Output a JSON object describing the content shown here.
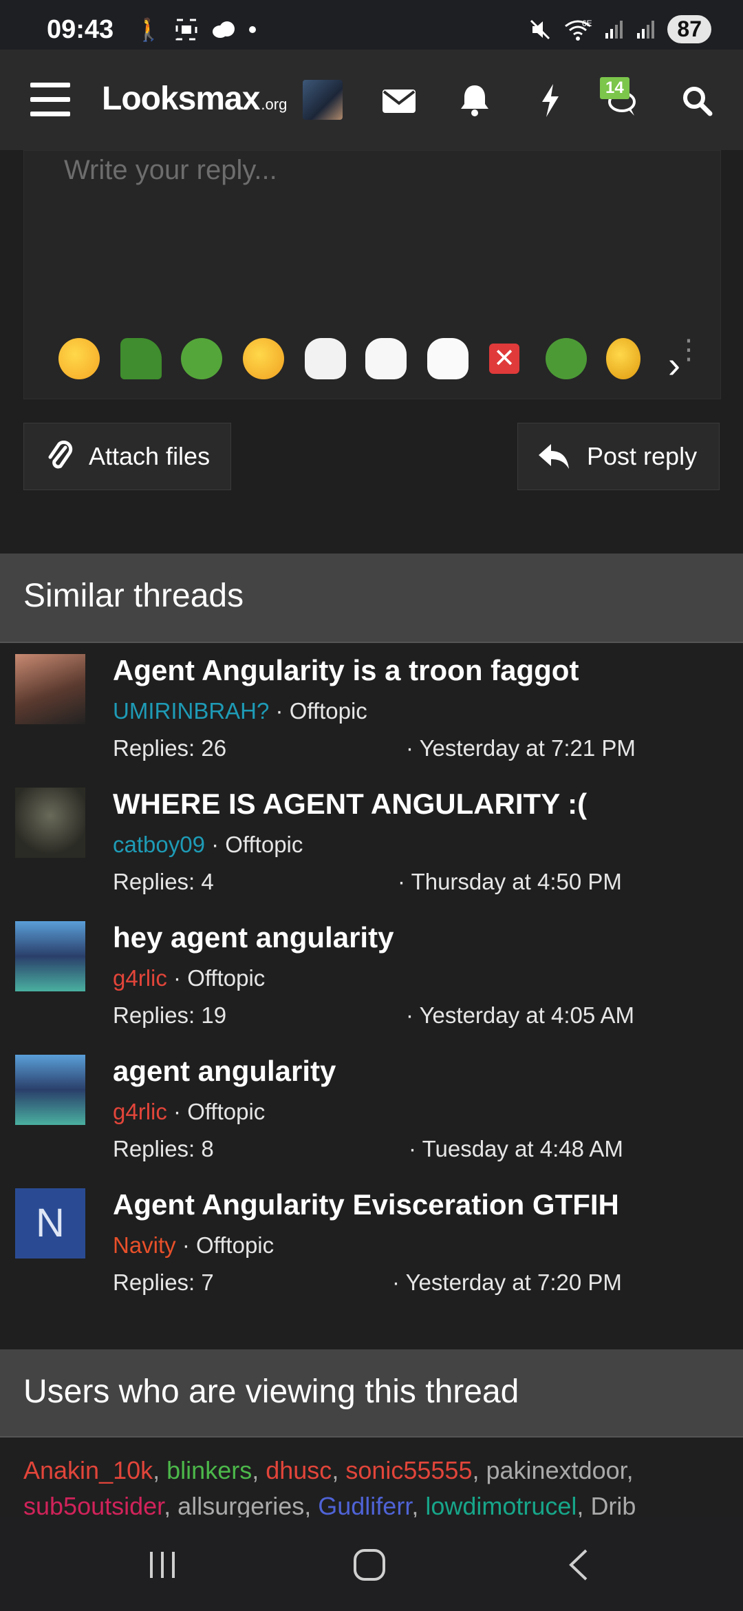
{
  "status_bar": {
    "time": "09:43",
    "network": "6E",
    "battery": "87"
  },
  "header": {
    "logo_main": "Looksmax",
    "logo_suffix": ".org",
    "messages_badge": "14"
  },
  "editor": {
    "placeholder": "Write your reply...",
    "emojis": [
      "rofl-emoji",
      "pepe-emoji",
      "pepe-laugh-emoji",
      "joy-tears-emoji",
      "wojak-emoji",
      "crying-wojak-emoji",
      "soyjak-emoji",
      "x-mark-emoji",
      "pepe-grin-emoji",
      "grin-emoji"
    ]
  },
  "actions": {
    "attach_label": "Attach files",
    "post_label": "Post reply"
  },
  "similar": {
    "heading": "Similar threads",
    "threads": [
      {
        "title": "Agent Angularity is a troon faggot",
        "author": "UMIRINBRAH?",
        "author_color": "#1e9bb6",
        "forum": "Offtopic",
        "replies": "Replies: 26",
        "date": "Yesterday at 7:21 PM"
      },
      {
        "title": "WHERE IS AGENT ANGULARITY :(",
        "author": "catboy09",
        "author_color": "#1e9bb6",
        "forum": "Offtopic",
        "replies": "Replies: 4",
        "date": "Thursday at 4:50 PM"
      },
      {
        "title": "hey agent angularity",
        "author": "g4rlic",
        "author_color": "#e2453a",
        "forum": "Offtopic",
        "replies": "Replies: 19",
        "date": "Yesterday at 4:05 AM"
      },
      {
        "title": "agent angularity",
        "author": "g4rlic",
        "author_color": "#e2453a",
        "forum": "Offtopic",
        "replies": "Replies: 8",
        "date": "Tuesday at 4:48 AM"
      },
      {
        "title": "Agent Angularity Evisceration GTFIH",
        "author": "Navity",
        "author_color": "#e8502a",
        "forum": "Offtopic",
        "replies": "Replies: 7",
        "date": "Yesterday at 7:20 PM",
        "avatar_letter": "N"
      }
    ]
  },
  "viewers": {
    "heading": "Users who are viewing this thread",
    "users": [
      {
        "name": "Anakin_10k",
        "color": "#e2453a"
      },
      {
        "name": "blinkers",
        "color": "#4cb84a"
      },
      {
        "name": "dhusc",
        "color": "#e2453a"
      },
      {
        "name": "sonic55555",
        "color": "#e2453a"
      },
      {
        "name": "pakinextdoor",
        "color": "#aaaaaa"
      },
      {
        "name": "sub5outsider",
        "color": "#d1235b"
      },
      {
        "name": "allsurgeries",
        "color": "#aaaaaa"
      },
      {
        "name": "Gudliferr",
        "color": "#4f63d6"
      },
      {
        "name": "lowdimotrucel",
        "color": "#17a68a"
      },
      {
        "name": "Drib",
        "color": "#aaaaaa"
      }
    ]
  },
  "colors": {
    "background": "#1f1f1f",
    "section_header": "#444444",
    "accent_green": "#7cc64b"
  }
}
